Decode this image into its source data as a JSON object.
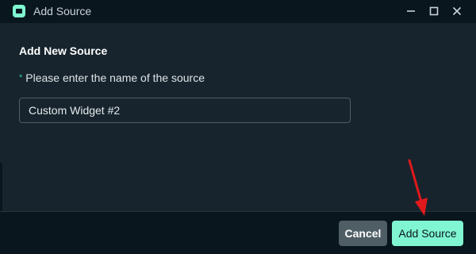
{
  "window": {
    "title": "Add Source",
    "controls": [
      "minimize-icon",
      "maximize-icon",
      "close-icon"
    ]
  },
  "form": {
    "heading": "Add New Source",
    "required_marker": "*",
    "field_label": "Please enter the name of the source",
    "name_value": "Custom Widget #2"
  },
  "footer": {
    "cancel_label": "Cancel",
    "submit_label": "Add Source"
  },
  "colors": {
    "accent": "#80f5d2",
    "titlebar": "#09161d",
    "panel": "#17242d",
    "secondary_button": "#4f5e65",
    "annotation_arrow": "#e0191c"
  }
}
